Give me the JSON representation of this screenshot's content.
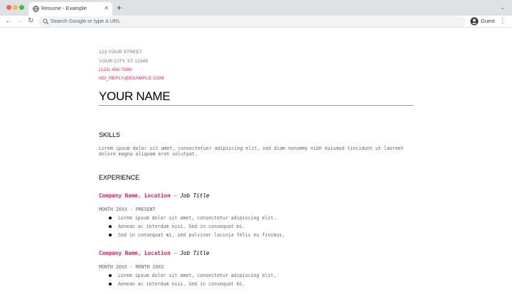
{
  "browser": {
    "tab_title": "Resume - Example",
    "tab_close": "✕",
    "new_tab": "+",
    "tab_menu": "⌄",
    "back": "←",
    "forward": "→",
    "reload": "↻",
    "omnibox_placeholder": "Search Google or type a URL",
    "profile_label": "Guest",
    "menu": "⋮"
  },
  "resume": {
    "contact": {
      "street": "123 YOUR STREET",
      "city": "YOUR CITY, ST 12345",
      "phone": "(123) 456-7890",
      "email": "NO_REPLY@EXAMPLE.COM"
    },
    "name": "YOUR NAME",
    "skills": {
      "heading": "SKILLS",
      "text": "Lorem ipsum dolor sit amet, consectetuer adipiscing elit, sed diam nonummy nibh euismod tincidunt ut laoreet dolore magna aliquam erat volutpat."
    },
    "experience": {
      "heading": "EXPERIENCE",
      "jobs": [
        {
          "company": "Company Name, Location",
          "separator": " — ",
          "title": "Job Title",
          "dates": "MONTH 20XX - PRESENT",
          "bullets": [
            "Lorem ipsum dolor sit amet, consectetur adipiscing elit.",
            "Aenean ac interdum nisi. Sed in consequat mi.",
            "Sed in consequat mi, sed pulvinar lacinia felis eu finibus."
          ]
        },
        {
          "company": "Company Name, Location",
          "separator": " — ",
          "title": "Job Title",
          "dates": "MONTH 20XX - MONTH 20XX",
          "bullets": [
            "Lorem ipsum dolor sit amet, consectetur adipiscing elit.",
            "Aenean ac interdum nisi. Sed in consequat mi."
          ]
        }
      ]
    }
  },
  "colors": {
    "accent": "#e91d63",
    "muted_text": "#757575",
    "chrome_bg": "#dee1e6"
  },
  "icons": {
    "favicon": "globe-icon",
    "search": "search-icon",
    "profile": "account-icon"
  }
}
